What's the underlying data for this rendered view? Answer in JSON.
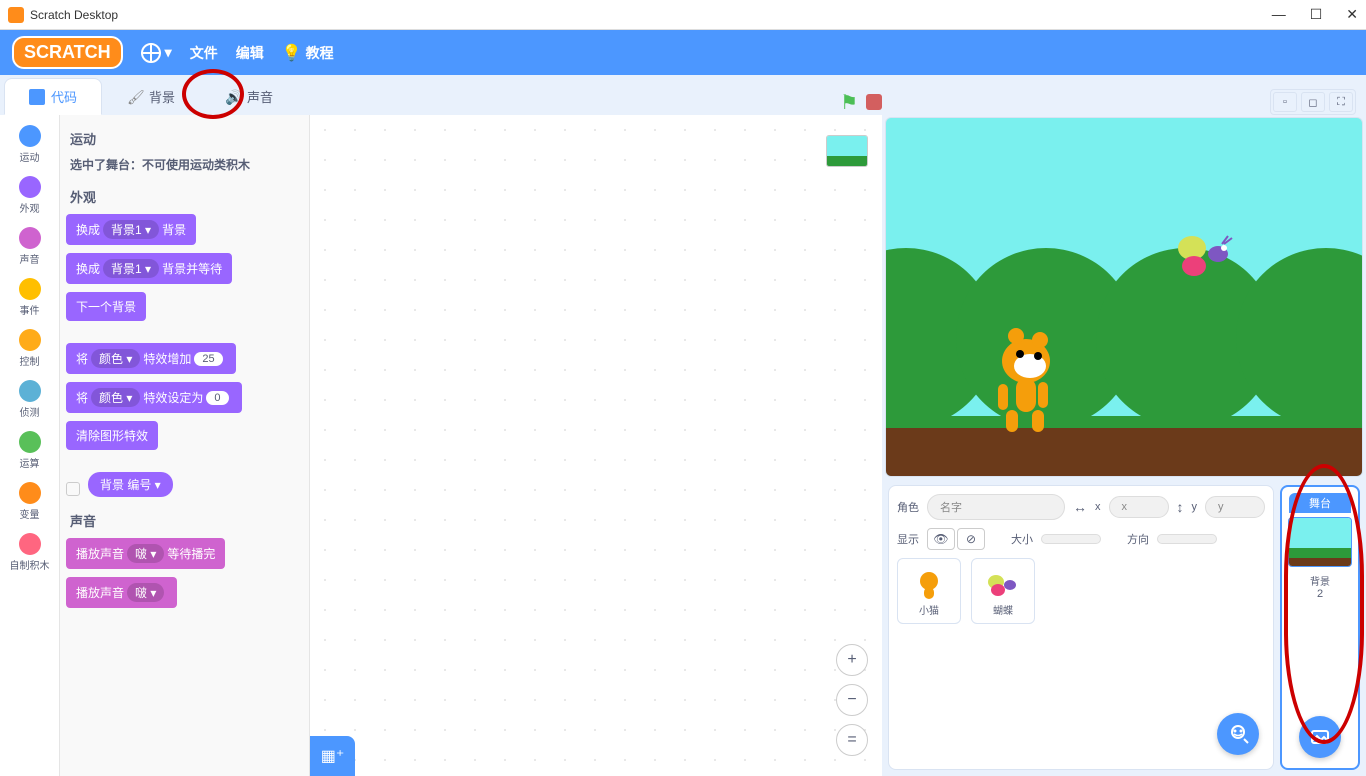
{
  "titlebar": {
    "title": "Scratch Desktop"
  },
  "menubar": {
    "logo": "SCRATCH",
    "file": "文件",
    "edit": "编辑",
    "tutorials": "教程"
  },
  "tabs": {
    "code": "代码",
    "backdrops": "背景",
    "sounds": "声音"
  },
  "categories": [
    {
      "name": "运动",
      "color": "#4C97FF"
    },
    {
      "name": "外观",
      "color": "#9966FF"
    },
    {
      "name": "声音",
      "color": "#CF63CF"
    },
    {
      "name": "事件",
      "color": "#FFBF00"
    },
    {
      "name": "控制",
      "color": "#FFAB19"
    },
    {
      "name": "侦测",
      "color": "#5CB1D6"
    },
    {
      "name": "运算",
      "color": "#59C059"
    },
    {
      "name": "变量",
      "color": "#FF8C1A"
    },
    {
      "name": "自制积木",
      "color": "#FF6680"
    }
  ],
  "palette": {
    "motion_header": "运动",
    "stage_selected_msg": "选中了舞台：不可使用运动类积木",
    "looks_header": "外观",
    "sound_header": "声音",
    "switch_backdrop": "换成",
    "backdrop1": "背景1 ▾",
    "backdrop_suffix": "背景",
    "switch_backdrop_wait_suffix": "背景并等待",
    "next_backdrop": "下一个背景",
    "change_effect_prefix": "将",
    "color_dd": "颜色 ▾",
    "change_effect_by": "特效增加",
    "effect_val": "25",
    "set_effect_to": "特效设定为",
    "set_val": "0",
    "clear_effects": "清除图形特效",
    "backdrop_number": "背景 编号 ▾",
    "play_sound": "播放声音",
    "pop": "啵 ▾",
    "until_done": "等待播完"
  },
  "sprite_info": {
    "sprite_label": "角色",
    "name_placeholder": "名字",
    "x_label": "x",
    "y_label": "y",
    "x_val": "x",
    "y_val": "y",
    "show_label": "显示",
    "size_label": "大小",
    "direction_label": "方向"
  },
  "sprites": [
    {
      "name": "小猫"
    },
    {
      "name": "蝴蝶"
    }
  ],
  "stage_panel": {
    "label": "舞台",
    "backdrop_label": "背景",
    "backdrop_count": "2"
  }
}
